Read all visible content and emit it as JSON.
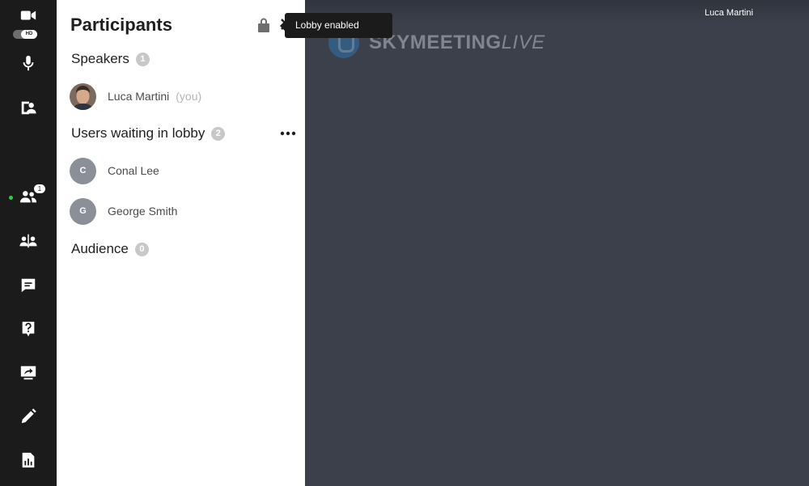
{
  "toolbar": {
    "hd_label": "HD",
    "participants_badge": "1",
    "buttons": [
      {
        "icon": "camera-icon"
      },
      {
        "icon": "microphone-icon"
      },
      {
        "icon": "contact-card-icon"
      },
      {
        "icon": "participants-icon"
      },
      {
        "icon": "breakout-rooms-icon"
      },
      {
        "icon": "chat-icon"
      },
      {
        "icon": "question-icon"
      },
      {
        "icon": "screen-share-icon"
      },
      {
        "icon": "pencil-icon"
      },
      {
        "icon": "report-icon"
      }
    ]
  },
  "panel": {
    "title": "Participants",
    "speakers": {
      "label": "Speakers",
      "count": "1",
      "people": [
        {
          "name": "Luca Martini",
          "suffix": "(you)"
        }
      ]
    },
    "lobby": {
      "label": "Users waiting in lobby",
      "count": "2",
      "people": [
        {
          "initial": "C",
          "name": "Conal Lee"
        },
        {
          "initial": "G",
          "name": "George Smith"
        }
      ]
    },
    "audience": {
      "label": "Audience",
      "count": "0"
    }
  },
  "tooltip": {
    "text": "Lobby enabled"
  },
  "stage": {
    "user_name": "Luca Martini",
    "logo_main": "SKYMEETING",
    "logo_live": "LIVE"
  },
  "colors": {
    "toolbar_bg": "#1b1b1b",
    "stage_bg": "#3b404b",
    "active_dot": "#2ecc40",
    "logo_blue": "#2d7fc4"
  }
}
